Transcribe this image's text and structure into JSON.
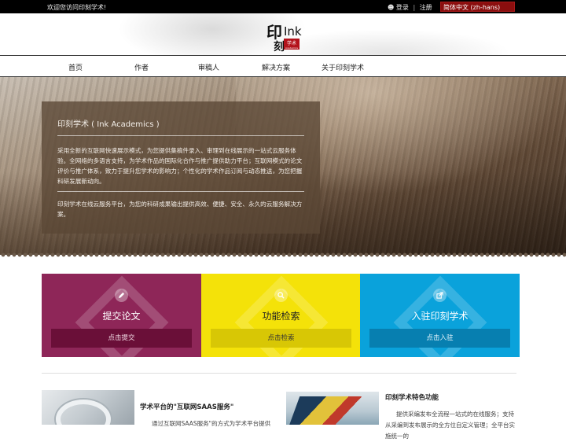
{
  "topbar": {
    "welcome": "欢迎您访问印刻学术!",
    "login": "登录",
    "separator": "|",
    "register": "注册",
    "language": "简体中文 (zh-hans)"
  },
  "logo": {
    "glyph_left": "印",
    "glyph_bottom": "刻",
    "ink_text": "Ink",
    "badge_text": "学术",
    "badge_sub": "Academics"
  },
  "nav": {
    "items": [
      "首页",
      "作者",
      "审稿人",
      "解决方案",
      "关于印刻学术"
    ]
  },
  "hero": {
    "title": "印刻学术 ( Ink Academics )",
    "paragraph1": "采用全新的互联网快速展示模式，为您提供集稿件录入、审理到在线展示的一站式云服务体验。全网络的多语言支持，为学术作品的国际化合作与推广提供助力平台；互联网模式的论文评价与推广体系，致力于提升您学术的影响力；个性化的学术作品订阅与动态推送，为您把握科研发展新动向。",
    "paragraph2": "印刻学术在线云服务平台，为您的科研成果输出提供高效、便捷、安全、永久的云服务解决方案。"
  },
  "cards": [
    {
      "label": "提交论文",
      "button": "点击提交",
      "icon": "edit-icon",
      "color": "#8e2658"
    },
    {
      "label": "功能检索",
      "button": "点击检索",
      "icon": "search-icon",
      "color": "#f4e209"
    },
    {
      "label": "入驻印刻学术",
      "button": "点击入驻",
      "icon": "external-link-icon",
      "color": "#0aa2db"
    }
  ],
  "bottom": {
    "left_title": "学术平台的\"互联网SAAS服务\"",
    "left_text": "通过互联网SAAS服务\"的方式为学术平台提供",
    "right_title": "印刻学术特色功能",
    "right_text": "提供采编发布全流程一站式的在线服务；支持从采编到发布展示的全方位自定义管理；全平台实施统一的"
  }
}
